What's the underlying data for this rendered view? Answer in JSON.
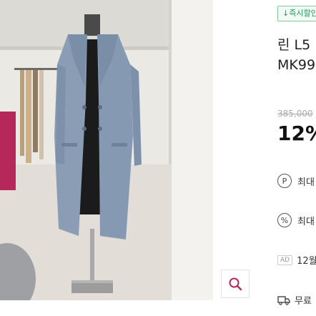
{
  "badge": {
    "label": "↓즉시할인"
  },
  "product": {
    "title_line1": "린 L5",
    "title_line2": "MK99",
    "original_price": "385,000",
    "discount": "12%"
  },
  "benefits": [
    {
      "icon": "point-icon",
      "glyph": "P",
      "label": "최대"
    },
    {
      "icon": "percent-icon",
      "glyph": "%",
      "label": "최대"
    }
  ],
  "ad": {
    "tag": "AD",
    "label": "12월"
  },
  "shipping": {
    "icon": "truck-icon",
    "label": "무료"
  },
  "zoom": {
    "icon": "magnifier-icon"
  },
  "colors": {
    "badge_green": "#1f9a5a",
    "coat": "#8a9db5",
    "accent": "#b7285a"
  }
}
